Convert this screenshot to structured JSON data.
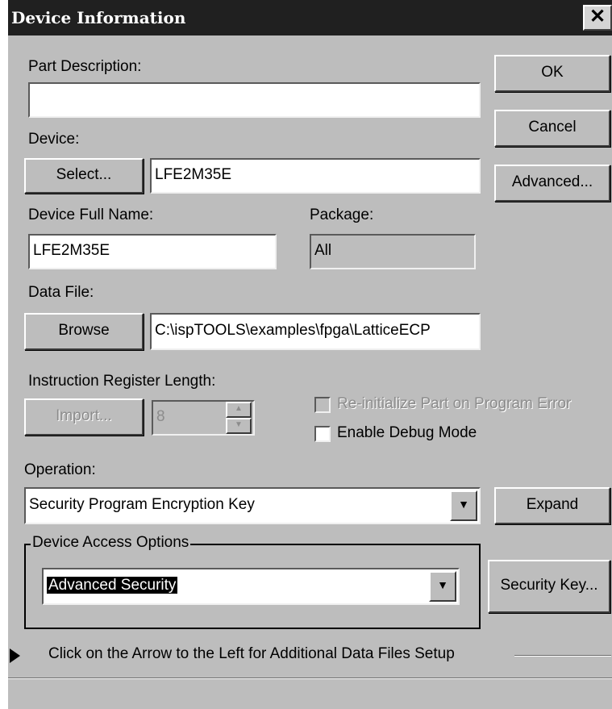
{
  "window": {
    "title": "Device Information",
    "close_glyph": "✕"
  },
  "labels": {
    "part_description": "Part Description:",
    "device": "Device:",
    "device_full_name": "Device Full Name:",
    "package": "Package:",
    "data_file": "Data File:",
    "instruction_register_length": "Instruction Register Length:",
    "operation": "Operation:"
  },
  "fields": {
    "part_description": "",
    "device": "LFE2M35E",
    "device_full_name": "LFE2M35E",
    "package": "All",
    "data_file": "C:\\ispTOOLS\\examples\\fpga\\LatticeECP",
    "ir_length": "8"
  },
  "buttons": {
    "ok": "OK",
    "cancel": "Cancel",
    "advanced": "Advanced...",
    "select": "Select...",
    "browse": "Browse",
    "import": "Import...",
    "expand": "Expand",
    "security_key": "Security Key..."
  },
  "checkboxes": {
    "reinit": {
      "label": "Re-initialize Part on Program Error",
      "checked": false,
      "enabled": false
    },
    "debug": {
      "label": "Enable Debug Mode",
      "checked": false,
      "enabled": true
    }
  },
  "operation": {
    "selected": "Security Program Encryption Key"
  },
  "device_access": {
    "group_label": "Device Access Options",
    "selected": "Advanced Security"
  },
  "footer": {
    "arrow_text": "Click on the Arrow to the Left for Additional Data Files Setup"
  },
  "icons": {
    "spin_up": "▲",
    "spin_down": "▼",
    "dropdown": "▼"
  }
}
